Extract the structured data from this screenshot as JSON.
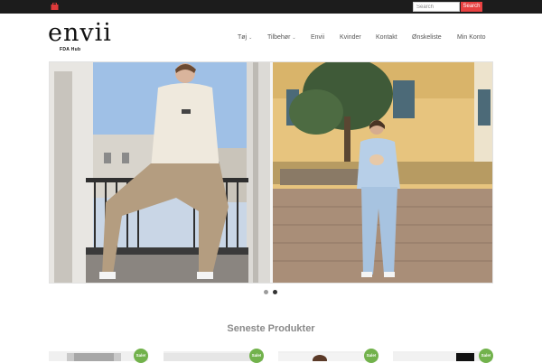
{
  "topbar": {
    "search_placeholder": "Search",
    "search_button": "Search",
    "colors": {
      "background": "#1c1c1c",
      "accent": "#e94141"
    }
  },
  "logo": {
    "name": "envii",
    "tagline": "FDA Hub"
  },
  "nav": {
    "items": [
      {
        "label": "Tøj",
        "dropdown": true
      },
      {
        "label": "Tilbehør",
        "dropdown": true
      },
      {
        "label": "Envii",
        "dropdown": false
      },
      {
        "label": "Kvinder",
        "dropdown": false
      },
      {
        "label": "Kontakt",
        "dropdown": false
      },
      {
        "label": "Ønskeliste",
        "dropdown": false
      },
      {
        "label": "Min Konto",
        "dropdown": false
      }
    ]
  },
  "slider": {
    "slides": 2,
    "active_slide": 2
  },
  "section": {
    "title": "Seneste Produkter"
  },
  "products": [
    {
      "badge": "Sale!"
    },
    {
      "badge": "Sale!"
    },
    {
      "badge": "Sale!"
    },
    {
      "badge": "Sale!"
    }
  ],
  "icons": {
    "cart": "shopping-bag-icon",
    "dropdown": "chevron-down-icon"
  }
}
